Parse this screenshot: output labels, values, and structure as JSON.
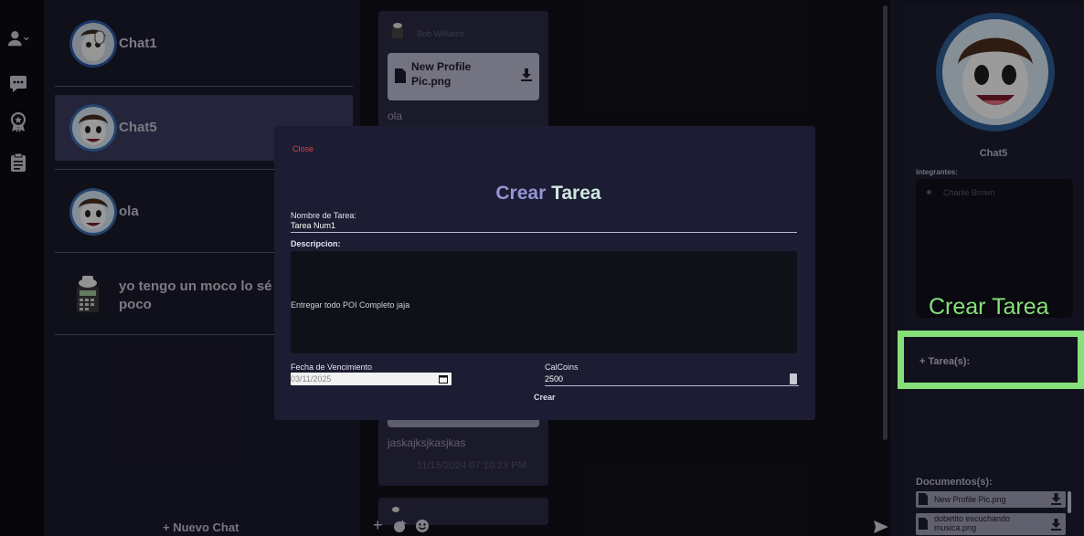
{
  "chat_list": {
    "chats": [
      {
        "name": "Chat1"
      },
      {
        "name": "Chat5"
      },
      {
        "name": "ola"
      },
      {
        "name": "yo tengo un moco lo sé poco"
      }
    ],
    "new_chat_label": "+ Nuevo Chat"
  },
  "messages": {
    "sender_top": "Bob Williams",
    "file1_name": "New Profile Pic.png",
    "text1": "ola",
    "text2": "jaskajksjkasjkas",
    "timestamp": "11/15/2024 07:10:23 PM"
  },
  "modal": {
    "close_label": "Close",
    "title_a": "Crear",
    "title_b": "Tarea",
    "name_label": "Nombre de Tarea:",
    "name_value": "Tarea Num1",
    "desc_label": "Descripcion:",
    "desc_value": "Entregar todo POI Completo jaja",
    "date_label": "Fecha de Vencimiento",
    "date_value": "03/11/2025",
    "coins_label": "CalCoins",
    "coins_value": "2500",
    "submit_label": "Crear"
  },
  "right_panel": {
    "chat_name": "Chat5",
    "members_label": "integrantes:",
    "members": [
      "Charlie Brown"
    ],
    "tasks_label": "+ Tarea(s):",
    "docs_label": "Documentos(s):",
    "docs": [
      "New Profile Pic.png",
      "dobetito escuchando musica.png"
    ]
  },
  "annotation": {
    "label": "Crear Tarea",
    "color": "#86e07a"
  }
}
